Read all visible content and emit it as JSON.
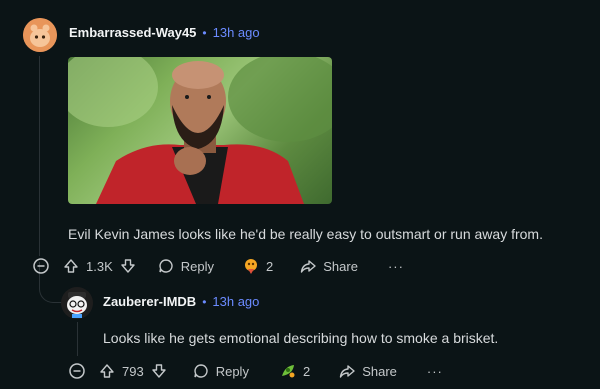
{
  "comment": {
    "username": "Embarrassed-Way45",
    "separator": "•",
    "time": "13h ago",
    "text": "Evil Kevin James looks like he'd be really easy to outsmart or run away from.",
    "upvotes": "1.3K",
    "reply_label": "Reply",
    "award_count": "2",
    "share_label": "Share",
    "more_label": "···"
  },
  "reply": {
    "username": "Zauberer-IMDB",
    "separator": "•",
    "time": "13h ago",
    "text": "Looks like he gets emotional describing how to smoke a brisket.",
    "upvotes": "793",
    "reply_label": "Reply",
    "award_count": "2",
    "share_label": "Share",
    "more_label": "···"
  },
  "icons": {
    "collapse": "minus-circle-icon",
    "upvote": "arrow-up-icon",
    "downvote": "arrow-down-icon",
    "reply": "speech-bubble-icon",
    "award": "award-icon",
    "share": "share-arrow-icon"
  },
  "colors": {
    "background": "#0b1416",
    "link": "#6b8bff",
    "text": "#d7dadc"
  }
}
